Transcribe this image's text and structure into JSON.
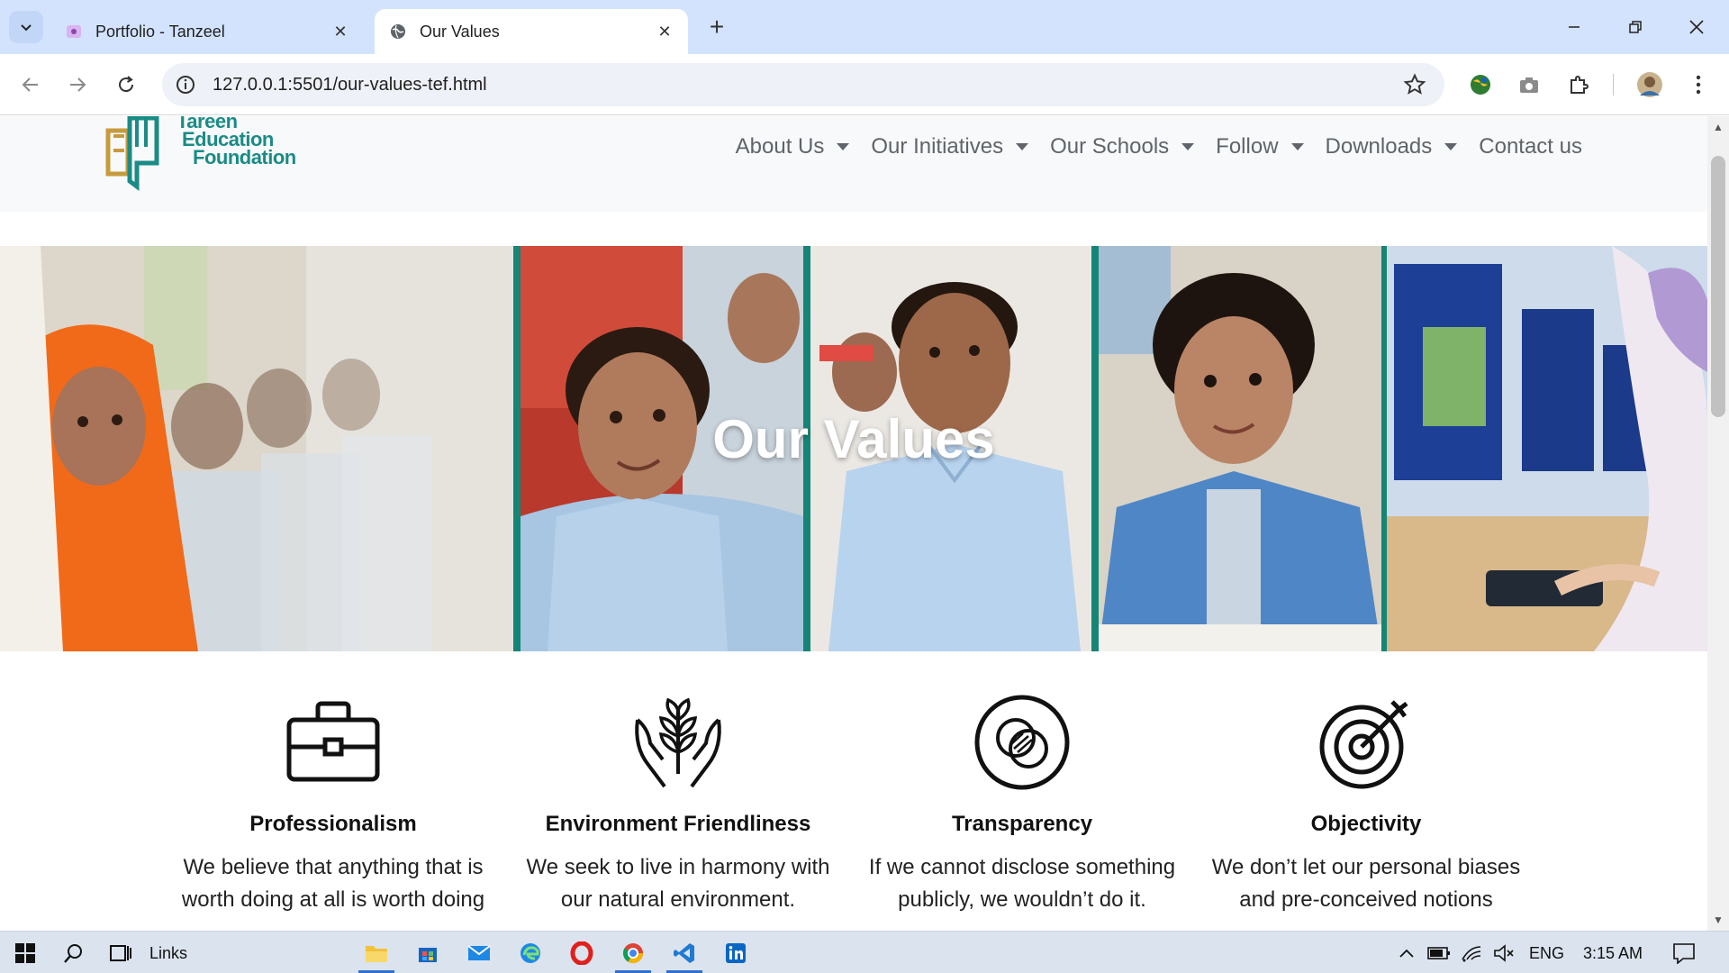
{
  "browser": {
    "tabs": [
      {
        "title": "Portfolio - Tanzeel",
        "active": false
      },
      {
        "title": "Our Values",
        "active": true
      }
    ],
    "url": "127.0.0.1:5501/our-values-tef.html"
  },
  "site": {
    "logo_lines": [
      "Tareen",
      "Education",
      "Foundation"
    ],
    "nav": [
      {
        "label": "About Us",
        "dropdown": true
      },
      {
        "label": "Our Initiatives",
        "dropdown": true
      },
      {
        "label": "Our Schools",
        "dropdown": true
      },
      {
        "label": "Follow",
        "dropdown": true
      },
      {
        "label": "Downloads",
        "dropdown": true
      },
      {
        "label": "Contact us",
        "dropdown": false
      }
    ],
    "hero_title": "Our Values",
    "values": [
      {
        "title": "Professionalism",
        "text_lines": [
          "We believe that anything that is",
          "worth doing at all is worth doing"
        ],
        "icon": "briefcase-icon"
      },
      {
        "title": "Environment Friendliness",
        "text_lines": [
          "We seek to live in harmony with",
          "our natural environment."
        ],
        "icon": "plant-in-hands-icon"
      },
      {
        "title": "Transparency",
        "text_lines": [
          "If we cannot disclose something",
          "publicly, we wouldn’t do it."
        ],
        "icon": "overlapping-circles-icon"
      },
      {
        "title": "Objectivity",
        "text_lines": [
          "We don’t let our personal biases",
          "and pre-conceived notions"
        ],
        "icon": "target-icon"
      }
    ]
  },
  "taskbar": {
    "links_label": "Links",
    "language": "ENG",
    "time": "3:15 AM"
  },
  "colors": {
    "brand_teal": "#1b8b86",
    "tabbar": "#d3e3fd",
    "taskbar": "#dbe3ee"
  }
}
